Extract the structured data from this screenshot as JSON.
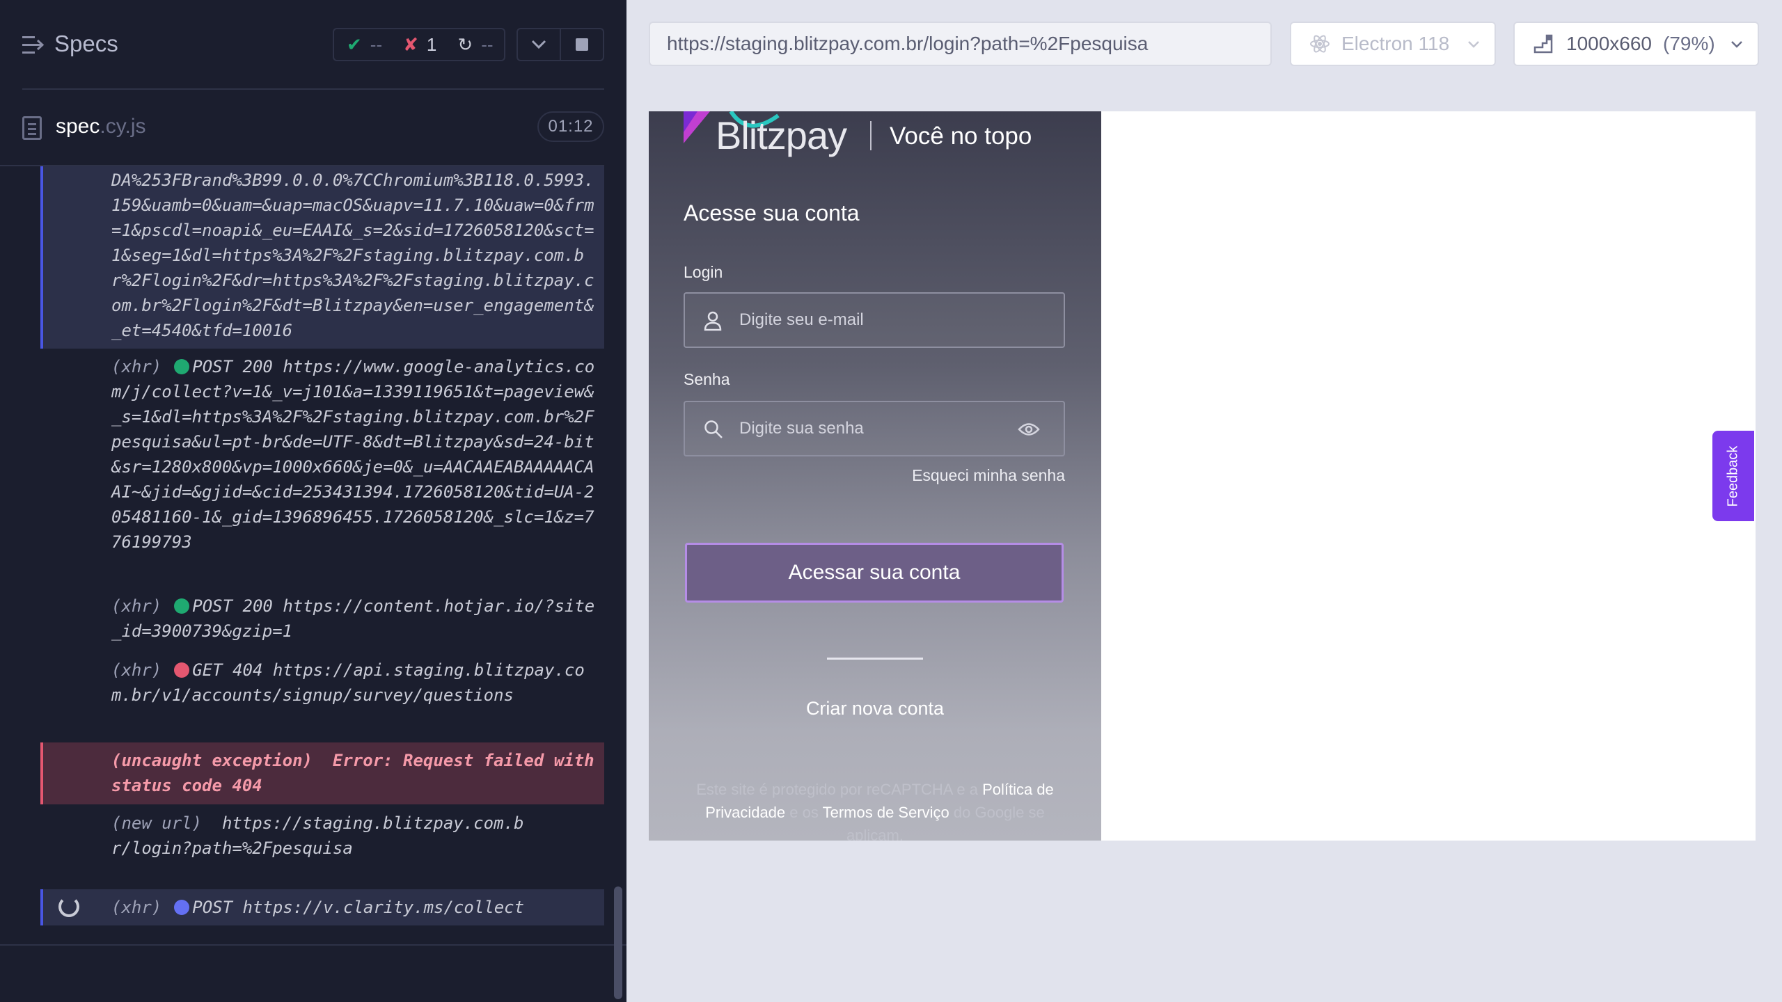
{
  "reporter": {
    "specs_label": "Specs",
    "stats": {
      "passed": "--",
      "failed": "1",
      "pending": "--"
    },
    "spec": {
      "name": "spec",
      "ext": ".cy.js",
      "duration": "01:12"
    },
    "commands": [
      {
        "name": "",
        "method": "",
        "status": "",
        "url": "DA%253FBrand%3B99.0.0.0%7CChromium%3B118.0.5993.159&uamb=0&uam=&uap=macOS&uapv=11.7.10&uaw=0&frm=1&pscdl=noapi&_eu=EAAI&_s=2&sid=1726058120&sct=1&seg=1&dl=https%3A%2F%2Fstaging.blitzpay.com.br%2Flogin%2F&dr=https%3A%2F%2Fstaging.blitzpay.com.br%2Flogin%2F&dt=Blitzpay&en=user_engagement&_et=4540&tfd=10016"
      },
      {
        "name": "(xhr)",
        "method": "POST",
        "status": "200",
        "url": "https://www.google-analytics.com/j/collect?v=1&_v=j101&a=1339119651&t=pageview&_s=1&dl=https%3A%2F%2Fstaging.blitzpay.com.br%2Fpesquisa&ul=pt-br&de=UTF-8&dt=Blitzpay&sd=24-bit&sr=1280x800&vp=1000x660&je=0&_u=AACAAEABAAAAACAAI~&jid=&gjid=&cid=253431394.1726058120&tid=UA-205481160-1&_gid=1396896455.1726058120&_slc=1&z=776199793"
      },
      {
        "name": "(xhr)",
        "method": "POST",
        "status": "200",
        "url": "https://content.hotjar.io/?site_id=3900739&gzip=1"
      },
      {
        "name": "(xhr)",
        "method": "GET",
        "status": "404",
        "url": "https://api.staging.blitzpay.com.br/v1/accounts/signup/survey/questions"
      },
      {
        "name": "(uncaught exception)",
        "message": "Error: Request failed with status code 404"
      },
      {
        "name": "(new url)",
        "url": "https://staging.blitzpay.com.br/login?path=%2Fpesquisa"
      },
      {
        "name": "(xhr)",
        "method": "POST",
        "url": "https://v.clarity.ms/collect"
      }
    ]
  },
  "aut": {
    "url": "https://staging.blitzpay.com.br/login?path=%2Fpesquisa",
    "browser": "Electron 118",
    "viewport": "1000x660",
    "scale": "(79%)"
  },
  "app": {
    "brand": "Blitzpay",
    "tagline": "Você no topo",
    "form_title": "Acesse sua conta",
    "login_label": "Login",
    "login_placeholder": "Digite seu e-mail",
    "password_label": "Senha",
    "password_placeholder": "Digite sua senha",
    "forgot_password": "Esqueci minha senha",
    "submit": "Acessar sua conta",
    "create_account": "Criar nova conta",
    "recaptcha": {
      "pre": "Este site é protegido por reCAPTCHA e a ",
      "privacy": "Política de Privacidade",
      "mid": " e os ",
      "terms": "Termos de Serviço",
      "post": " do Google se aplicam."
    },
    "feedback": "Feedback"
  },
  "colors": {
    "reporter_bg": "#1b1e2e",
    "passed": "#1fa971",
    "failed": "#e45770",
    "xhr_blue": "#6470f3",
    "accent_purple": "#7c3aed"
  },
  "icons": [
    "specs-menu-icon",
    "check-icon",
    "x-icon",
    "spinner-icon",
    "chevron-down-icon",
    "stop-icon",
    "file-icon",
    "electron-icon",
    "viewport-icon",
    "user-icon",
    "search-icon",
    "eye-icon"
  ]
}
